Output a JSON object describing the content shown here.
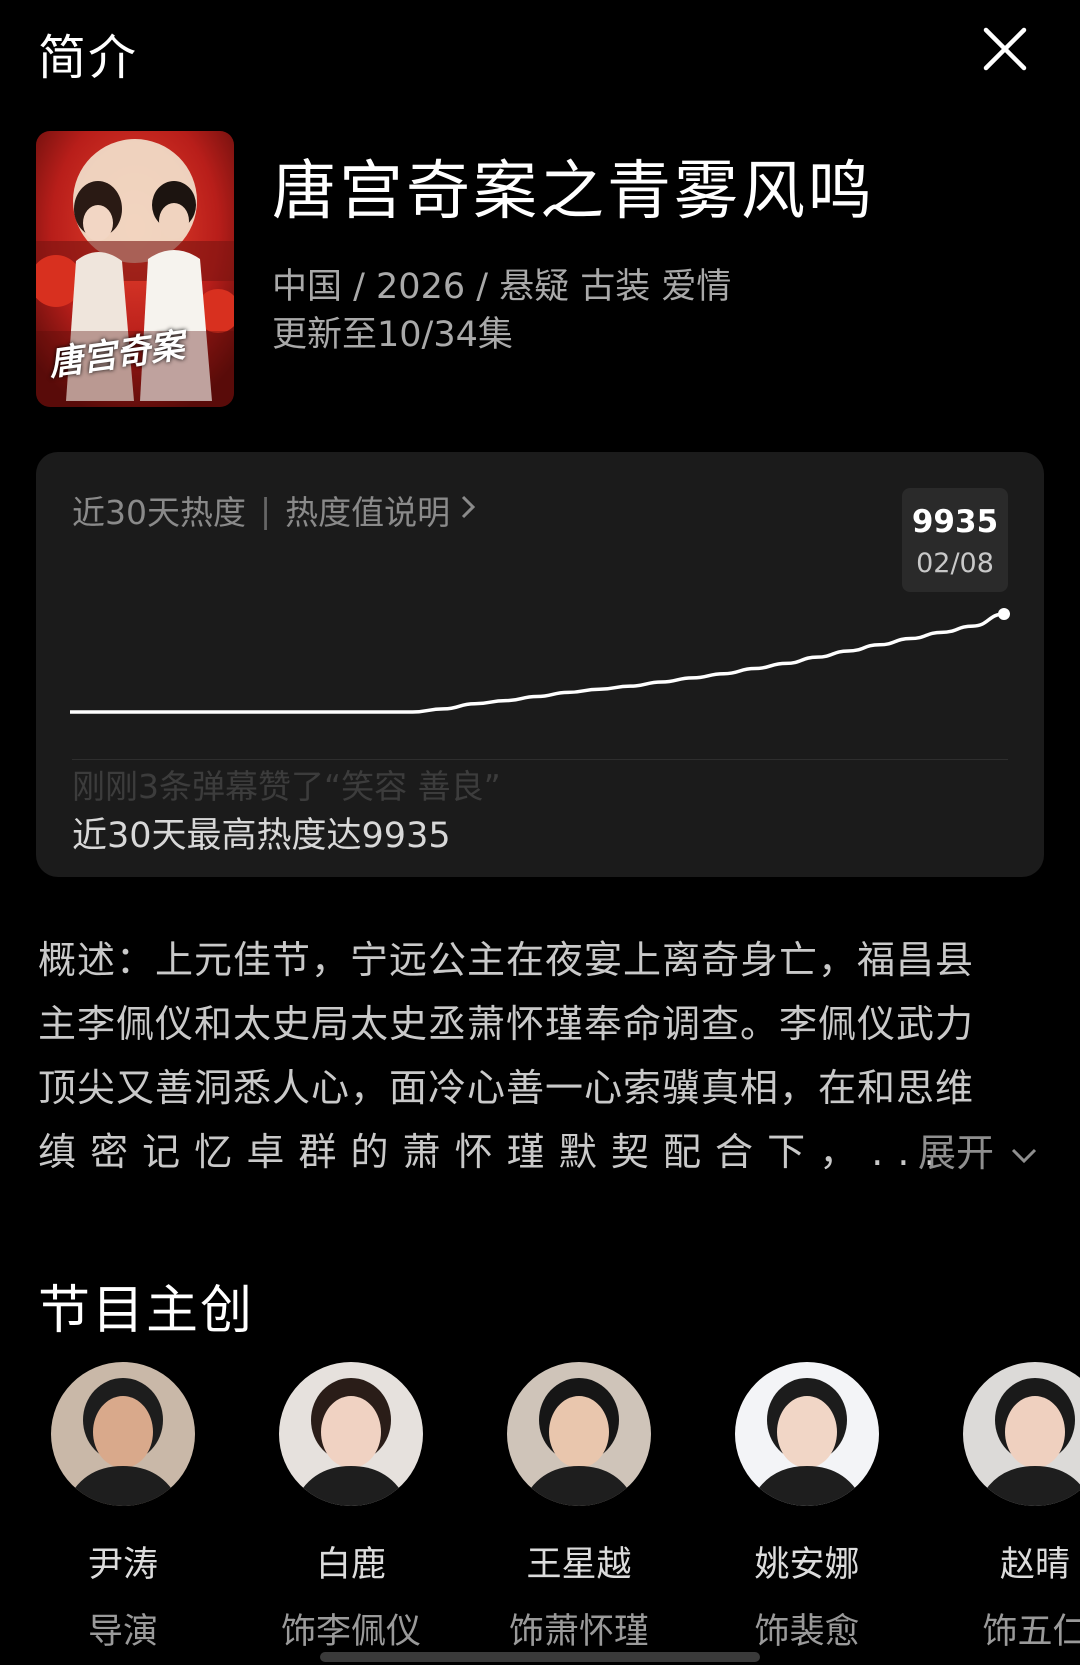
{
  "header": {
    "title": "简介",
    "close_icon": "close-icon"
  },
  "show": {
    "title": "唐宫奇案之青雾风鸣",
    "meta": "中国 / 2026 / 悬疑 古装 爱情",
    "update": "更新至10/34集",
    "poster_text": "唐宫奇案",
    "poster_colors": {
      "bg": "#b81e1a",
      "dark": "#5a0c0a",
      "moon": "#f3e4cf"
    }
  },
  "heat_card": {
    "label": "近30天热度",
    "link": "热度值说明",
    "tooltip_value": "9935",
    "tooltip_date": "02/08",
    "ticker": "刚刚3条弹幕赞了“笑容 善良”",
    "footer": "近30天最高热度达9935"
  },
  "chart_data": {
    "type": "line",
    "series": [
      {
        "values": [
          5200,
          5200,
          5200,
          5200,
          5200,
          5200,
          5200,
          5200,
          5200,
          5200,
          5200,
          5200,
          5350,
          5600,
          5750,
          5950,
          6150,
          6300,
          6450,
          6650,
          6850,
          7050,
          7300,
          7550,
          7850,
          8150,
          8450,
          8750,
          9050,
          9350,
          9935
        ]
      }
    ],
    "grid": false,
    "line_color": "#ffffff",
    "highlight_last_point": true
  },
  "synopsis": {
    "lines": [
      "概述：上元佳节，宁远公主在夜宴上离奇身亡，福昌县",
      "主李佩仪和太史局太史丞萧怀瑾奉命调查。李佩仪武力",
      "顶尖又善洞悉人心，面冷心善一心索骥真相，在和思维",
      "缜 密 记 忆 卓 群 的 萧 怀 瑾 默 契 配 合 下 ， . . ."
    ],
    "expand_label": "展开"
  },
  "crew": {
    "title": "节目主创",
    "people": [
      {
        "name": "尹涛",
        "role": "导演",
        "skin": "#d9a98b",
        "hair": "#1d1d1d",
        "bg": "#c9b8a8"
      },
      {
        "name": "白鹿",
        "role": "饰李佩仪",
        "skin": "#f0d2c2",
        "hair": "#2a1d18",
        "bg": "#e6e1dd"
      },
      {
        "name": "王星越",
        "role": "饰萧怀瑾",
        "skin": "#e9c6ad",
        "hair": "#161616",
        "bg": "#cfc4b9"
      },
      {
        "name": "姚安娜",
        "role": "饰裴愈",
        "skin": "#f1d6c6",
        "hair": "#1c1c1c",
        "bg": "#f3f4f7"
      },
      {
        "name": "赵晴",
        "role": "饰五仁",
        "skin": "#efd0bf",
        "hair": "#1a1a1a",
        "bg": "#dcdad8"
      }
    ]
  }
}
